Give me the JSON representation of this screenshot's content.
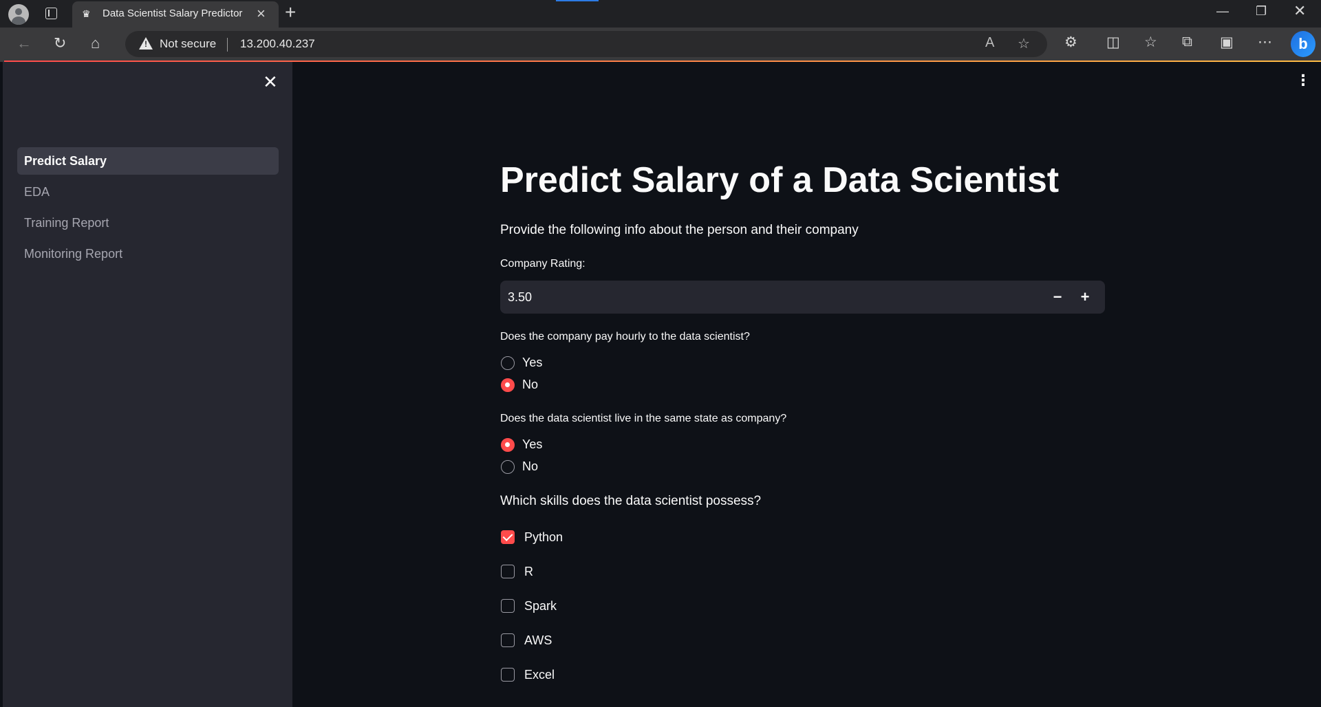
{
  "browser": {
    "tab_title": "Data Scientist Salary Predictor",
    "favicon": "crown-icon",
    "security_label": "Not secure",
    "url": "13.200.40.237"
  },
  "sidebar": {
    "items": [
      {
        "label": "Predict Salary",
        "active": true
      },
      {
        "label": "EDA",
        "active": false
      },
      {
        "label": "Training Report",
        "active": false
      },
      {
        "label": "Monitoring Report",
        "active": false
      }
    ]
  },
  "main": {
    "title": "Predict Salary of a Data Scientist",
    "subtitle": "Provide the following info about the person and their company",
    "rating": {
      "label": "Company Rating:",
      "value": "3.50",
      "minus": "−",
      "plus": "+"
    },
    "hourly": {
      "question": "Does the company pay hourly to the data scientist?",
      "options": [
        "Yes",
        "No"
      ],
      "selected": "No"
    },
    "same_state": {
      "question": "Does the data scientist live in the same state as company?",
      "options": [
        "Yes",
        "No"
      ],
      "selected": "Yes"
    },
    "skills": {
      "question": "Which skills does the data scientist possess?",
      "items": [
        {
          "label": "Python",
          "checked": true
        },
        {
          "label": "R",
          "checked": false
        },
        {
          "label": "Spark",
          "checked": false
        },
        {
          "label": "AWS",
          "checked": false
        },
        {
          "label": "Excel",
          "checked": false
        }
      ]
    }
  },
  "colors": {
    "accent": "#ff4b4b",
    "background": "#0e1117",
    "sidebar": "#262730"
  }
}
